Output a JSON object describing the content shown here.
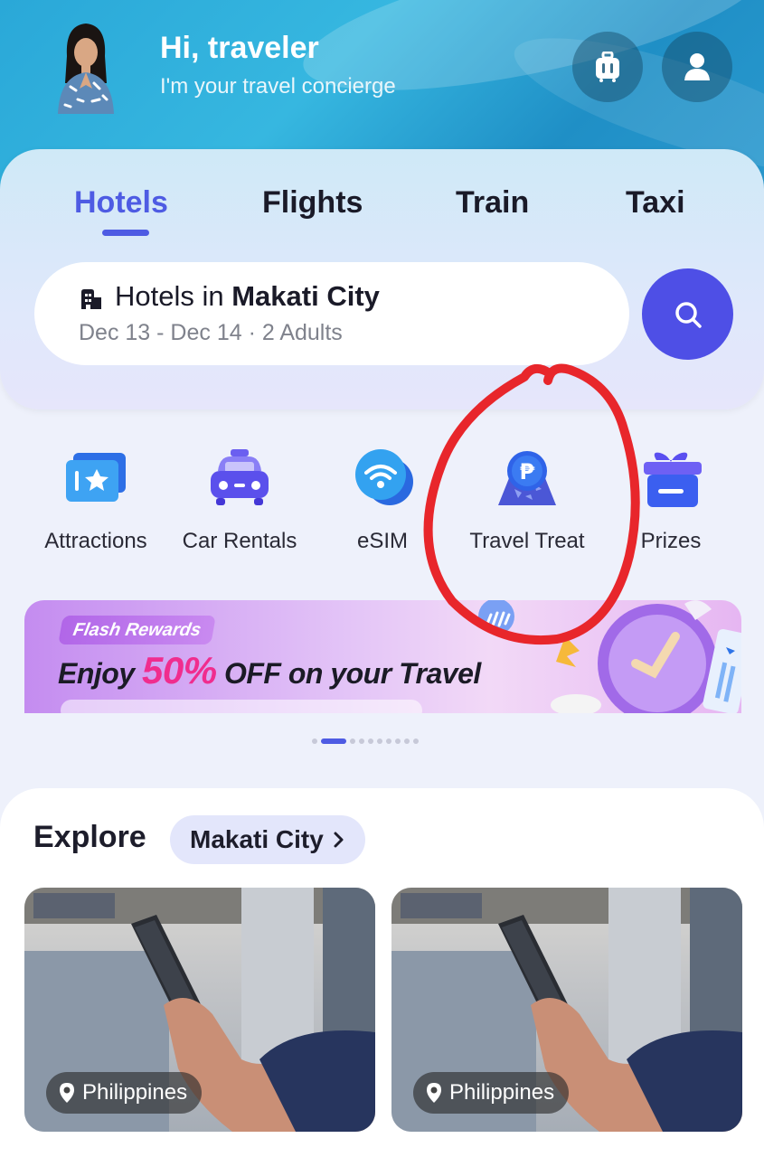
{
  "header": {
    "greeting": "Hi, traveler",
    "subtitle": "I'm your travel concierge",
    "luggage_icon": "luggage-icon",
    "profile_icon": "person-icon"
  },
  "tabs": [
    {
      "label": "Hotels",
      "active": true
    },
    {
      "label": "Flights",
      "active": false
    },
    {
      "label": "Train",
      "active": false
    },
    {
      "label": "Taxi",
      "active": false
    }
  ],
  "search": {
    "prefix": "Hotels in ",
    "city": "Makati City",
    "details": "Dec 13 - Dec 14 · 2 Adults",
    "icon": "building-icon",
    "button_icon": "search-icon"
  },
  "quick_links": [
    {
      "label": "Attractions",
      "icon": "ticket-icon"
    },
    {
      "label": "Car Rentals",
      "icon": "car-icon"
    },
    {
      "label": "eSIM",
      "icon": "wifi-icon"
    },
    {
      "label": "Travel Treat",
      "icon": "peso-coin-icon"
    },
    {
      "label": "Prizes",
      "icon": "gift-icon"
    }
  ],
  "banner": {
    "tag": "Flash Rewards",
    "title_pre": "Enjoy ",
    "title_pct": "50%",
    "title_post": " OFF on your Travel",
    "page_index": 1,
    "page_count": 10
  },
  "explore": {
    "title": "Explore",
    "city": "Makati City",
    "cards": [
      {
        "location": "Philippines"
      },
      {
        "location": "Philippines"
      }
    ]
  },
  "colors": {
    "accent": "#4e5be3",
    "search_button": "#4e4fe6",
    "annotation": "#e8262b",
    "banner_percent": "#f02d8e"
  }
}
